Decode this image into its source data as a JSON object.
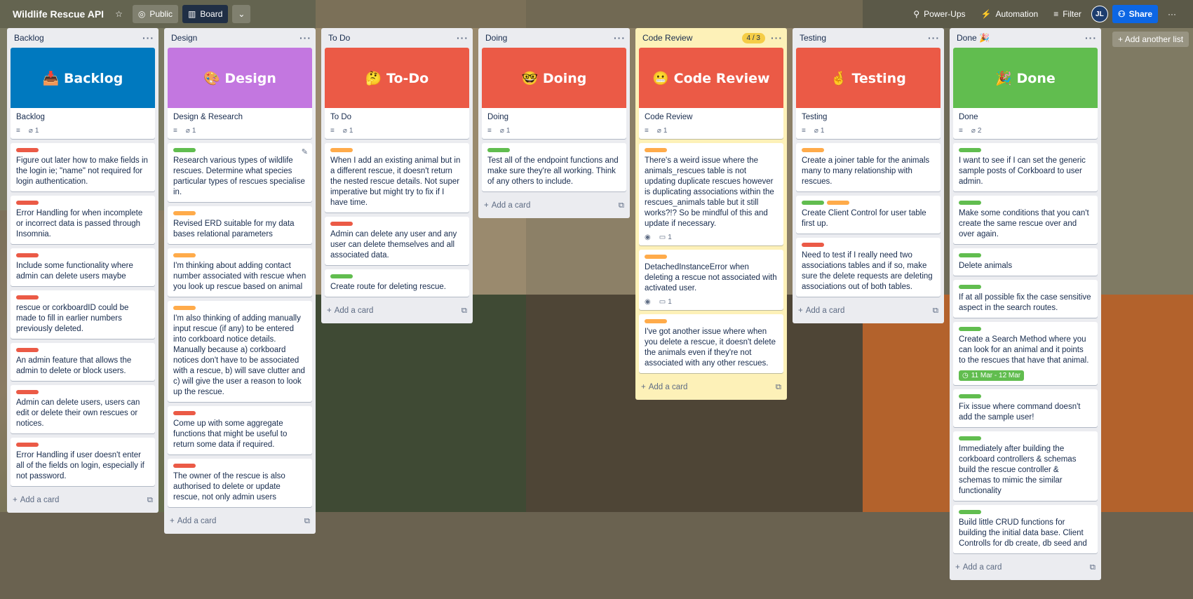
{
  "header": {
    "title": "Wildlife Rescue API",
    "visibility": "Public",
    "view": "Board",
    "power_ups": "Power-Ups",
    "automation": "Automation",
    "filter": "Filter",
    "avatar_initials": "JL",
    "share": "Share"
  },
  "add_another_list": "Add another list",
  "add_card": "Add a card",
  "lists": [
    {
      "name": "Backlog",
      "cover": {
        "title": "📥 Backlog",
        "color": "#0079bf",
        "text": "Backlog",
        "attachments": "1"
      },
      "cards": [
        {
          "labels": [
            "red"
          ],
          "text": "Figure out later how to make fields in the login ie; \"name\" not required for login authentication."
        },
        {
          "labels": [
            "red"
          ],
          "text": "Error Handling for when incomplete or incorrect data is passed through Insomnia."
        },
        {
          "labels": [
            "red"
          ],
          "text": "Include some functionality where admin can delete users maybe"
        },
        {
          "labels": [
            "red"
          ],
          "text": "rescue or corkboardID could be made to fill in earlier numbers previously deleted."
        },
        {
          "labels": [
            "red"
          ],
          "text": "An admin feature that allows the admin to delete or block users."
        },
        {
          "labels": [
            "red"
          ],
          "text": "Admin can delete users, users can edit or delete their own rescues or notices."
        },
        {
          "labels": [
            "red"
          ],
          "text": "Error Handling if user doesn't enter all of the fields on login, especially if not password."
        }
      ]
    },
    {
      "name": "Design",
      "cover": {
        "title": "🎨 Design",
        "color": "#c377e0",
        "text": "Design & Research",
        "attachments": "1"
      },
      "cards": [
        {
          "labels": [
            "green"
          ],
          "text": "Research various types of wildlife rescues. Determine what species particular types of rescues specialise in."
        },
        {
          "labels": [
            "orange"
          ],
          "text": "Revised ERD suitable for my data bases relational parameters"
        },
        {
          "labels": [
            "orange"
          ],
          "text": "I'm thinking about adding contact number associated with rescue when you look up rescue based on animal"
        },
        {
          "labels": [
            "orange"
          ],
          "text": "I'm also thinking of adding manually input rescue (if any) to be entered into corkboard notice details. Manually because a) corkboard notices don't have to be associated with a rescue, b) will save clutter and c) will give the user a reason to look up the rescue."
        },
        {
          "labels": [
            "red"
          ],
          "text": "Come up with some aggregate functions that might be useful to return some data if required."
        },
        {
          "labels": [
            "red"
          ],
          "text": "The owner of the rescue is also authorised to delete or update rescue, not only admin users"
        }
      ]
    },
    {
      "name": "To Do",
      "cover": {
        "title": "🤔 To-Do",
        "color": "#eb5a46",
        "text": "To Do",
        "attachments": "1"
      },
      "cards": [
        {
          "labels": [
            "orange"
          ],
          "text": "When I add an existing animal but in a different rescue, it doesn't return the nested rescue details. Not super imperative but might try to fix if I have time."
        },
        {
          "labels": [
            "red"
          ],
          "text": "Admin can delete any user and any user can delete themselves and all associated data."
        },
        {
          "labels": [
            "green"
          ],
          "text": "Create route for deleting rescue."
        }
      ]
    },
    {
      "name": "Doing",
      "cover": {
        "title": "🤓 Doing",
        "color": "#eb5a46",
        "text": "Doing",
        "attachments": "1"
      },
      "cards": [
        {
          "labels": [
            "green"
          ],
          "text": "Test all of the endpoint functions and make sure they're all working. Think of any others to include."
        }
      ]
    },
    {
      "name": "Code Review",
      "badge": "4 / 3",
      "cover": {
        "title": "😬 Code Review",
        "color": "#eb5a46",
        "text": "Code Review",
        "attachments": "1"
      },
      "cards": [
        {
          "labels": [
            "orange"
          ],
          "text": "There's a weird issue where the animals_rescues table is not updating duplicate rescues however is duplicating associations within the rescues_animals table but it still works?!? So be mindful of this and update if necessary.",
          "comments": "1"
        },
        {
          "labels": [
            "orange"
          ],
          "text": "DetachedInstanceError when deleting a rescue not associated with activated user.",
          "comments": "1"
        },
        {
          "labels": [
            "orange"
          ],
          "text": "I've got another issue where when you delete a rescue, it doesn't delete the animals even if they're not associated with any other rescues."
        }
      ]
    },
    {
      "name": "Testing",
      "cover": {
        "title": "🤞 Testing",
        "color": "#eb5a46",
        "text": "Testing",
        "attachments": "1"
      },
      "cards": [
        {
          "labels": [
            "orange"
          ],
          "text": "Create a joiner table for the animals many to many relationship with rescues."
        },
        {
          "labels": [
            "green",
            "orange"
          ],
          "text": "Create Client Control for user table first up."
        },
        {
          "labels": [
            "red"
          ],
          "text": "Need to test if I really need two associations tables and if so, make sure the delete requests are deleting associations out of both tables."
        }
      ]
    },
    {
      "name": "Done 🎉",
      "cover": {
        "title": "🎉 Done",
        "color": "#61bd4f",
        "text": "Done",
        "attachments": "2"
      },
      "cards": [
        {
          "labels": [
            "green"
          ],
          "text": "I want to see if I can set the generic sample posts of Corkboard to user admin."
        },
        {
          "labels": [
            "green"
          ],
          "text": "Make some conditions that you can't create the same rescue over and over again."
        },
        {
          "labels": [
            "green"
          ],
          "text": "Delete animals"
        },
        {
          "labels": [
            "green"
          ],
          "text": "If at all possible fix the case sensitive aspect in the search routes."
        },
        {
          "labels": [
            "green"
          ],
          "text": "Create a Search Method where you can look for an animal and it points to the rescues that have that animal.",
          "due": "11 Mar - 12 Mar"
        },
        {
          "labels": [
            "green"
          ],
          "text": "Fix issue where command doesn't add the sample user!"
        },
        {
          "labels": [
            "green"
          ],
          "text": "Immediately after building the corkboard controllers & schemas build the rescue controller & schemas to mimic the similar functionality"
        },
        {
          "labels": [
            "green"
          ],
          "text": "Build little CRUD functions for building the initial data base. Client Controlls for db create, db seed and"
        }
      ]
    }
  ]
}
